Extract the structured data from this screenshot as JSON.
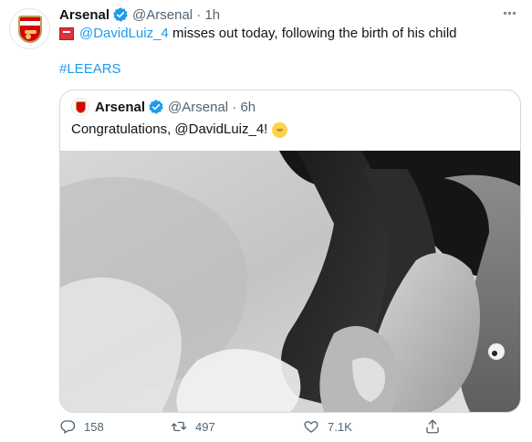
{
  "tweet": {
    "author_name": "Arsenal",
    "handle_time": "@Arsenal · 1h",
    "body_mention": "@DavidLuiz_4",
    "body_text": " misses out today, following the birth of his child",
    "hashtag": "#LEEARS"
  },
  "quoted": {
    "author_name": "Arsenal",
    "handle_time": "@Arsenal · 6h",
    "text": "Congratulations, @DavidLuiz_4!"
  },
  "actions": {
    "reply_count": "158",
    "retweet_count": "497",
    "like_count": "7.1K"
  },
  "colors": {
    "link": "#1d9bf0",
    "secondary_text": "#536471",
    "verified": "#1d9bf0",
    "brand_red": "#db0007"
  },
  "icons": [
    "arsenal-crest-avatar",
    "verified-badge-icon",
    "more-options-icon",
    "warning-light-emoji",
    "baby-emoji",
    "reply-icon",
    "retweet-icon",
    "like-icon",
    "share-icon"
  ]
}
